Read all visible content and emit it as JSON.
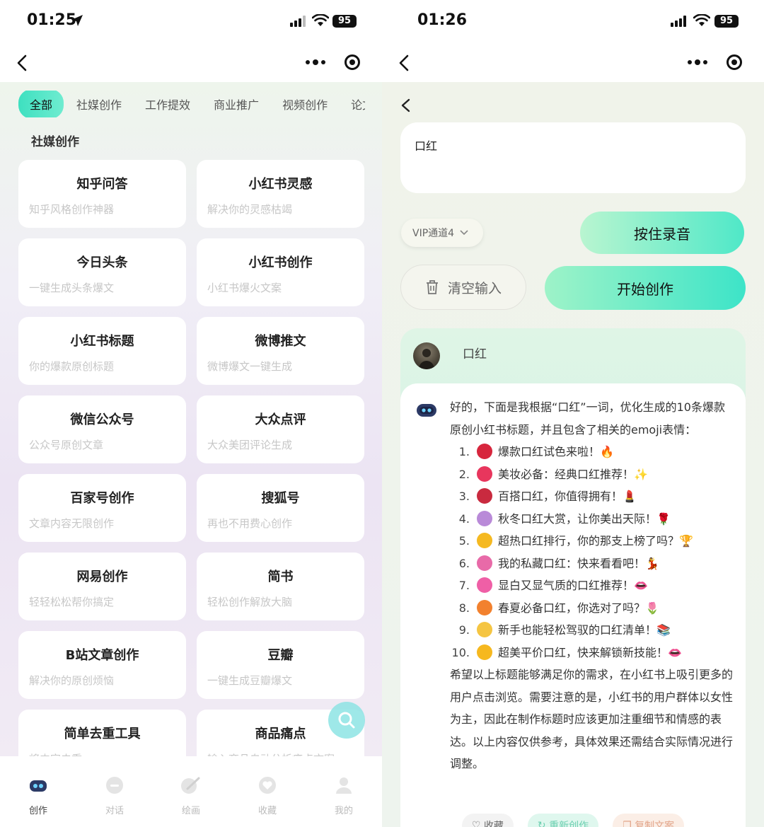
{
  "left": {
    "status": {
      "time": "01:25",
      "battery": "95"
    },
    "tabs": [
      "全部",
      "社媒创作",
      "工作提效",
      "商业推广",
      "视频创作",
      "论文"
    ],
    "section_title": "社媒创作",
    "cards": [
      {
        "title": "知乎问答",
        "subtitle": "知乎风格创作神器"
      },
      {
        "title": "小红书灵感",
        "subtitle": "解决你的灵感枯竭"
      },
      {
        "title": "今日头条",
        "subtitle": "一键生成头条爆文"
      },
      {
        "title": "小红书创作",
        "subtitle": "小红书爆火文案"
      },
      {
        "title": "小红书标题",
        "subtitle": "你的爆款原创标题"
      },
      {
        "title": "微博推文",
        "subtitle": "微博爆文一键生成"
      },
      {
        "title": "微信公众号",
        "subtitle": "公众号原创文章"
      },
      {
        "title": "大众点评",
        "subtitle": "大众美团评论生成"
      },
      {
        "title": "百家号创作",
        "subtitle": "文章内容无限创作"
      },
      {
        "title": "搜狐号",
        "subtitle": "再也不用费心创作"
      },
      {
        "title": "网易创作",
        "subtitle": "轻轻松松帮你搞定"
      },
      {
        "title": "简书",
        "subtitle": "轻松创作解放大脑"
      },
      {
        "title": "B站文章创作",
        "subtitle": "解决你的原创烦恼"
      },
      {
        "title": "豆瓣",
        "subtitle": "一键生成豆瓣爆文"
      },
      {
        "title": "简单去重工具",
        "subtitle": "将内容去重"
      },
      {
        "title": "商品痛点",
        "subtitle": "输入商品自动分析痛点文案"
      }
    ],
    "tabbar": [
      "创作",
      "对话",
      "绘画",
      "收藏",
      "我的"
    ]
  },
  "right": {
    "status": {
      "time": "01:26",
      "battery": "95"
    },
    "input_value": "口红",
    "vip_select": "VIP通道4",
    "record_button": "按住录音",
    "clear_button": "清空输入",
    "start_button": "开始创作",
    "user_message": "口红",
    "answer_intro": "好的，下面是我根据“口红”一词，优化生成的10条爆款原创小红书标题，并且包含了相关的emoji表情：",
    "answer_items": [
      {
        "num": "1.",
        "emoji_color": "#d7263d",
        "text": "爆款口红试色来啦！🔥"
      },
      {
        "num": "2.",
        "emoji_color": "#e8365d",
        "text": "美妆必备：经典口红推荐！✨"
      },
      {
        "num": "3.",
        "emoji_color": "#c92a3f",
        "text": "百搭口红，你值得拥有！💄"
      },
      {
        "num": "4.",
        "emoji_color": "#b98ad8",
        "text": "秋冬口红大赏，让你美出天际！🌹"
      },
      {
        "num": "5.",
        "emoji_color": "#f5b921",
        "text": "超热口红排行，你的那支上榜了吗？🏆"
      },
      {
        "num": "6.",
        "emoji_color": "#e86aa8",
        "text": "我的私藏口红：快来看看吧！💃"
      },
      {
        "num": "7.",
        "emoji_color": "#ef5fa6",
        "text": "显白又显气质的口红推荐！👄"
      },
      {
        "num": "8.",
        "emoji_color": "#f2812e",
        "text": "春夏必备口红，你选对了吗？🌷"
      },
      {
        "num": "9.",
        "emoji_color": "#f5c542",
        "text": "新手也能轻松驾驭的口红清单！📚"
      },
      {
        "num": "10.",
        "emoji_color": "#f6b81f",
        "text": "超美平价口红，快来解锁新技能！👄"
      }
    ],
    "answer_outro": "希望以上标题能够满足你的需求，在小红书上吸引更多的用户点击浏览。需要注意的是，小红书的用户群体以女性为主，因此在制作标题时应该更加注重细节和情感的表达。以上内容仅供参考，具体效果还需结合实际情况进行调整。",
    "actions": {
      "fav": "收藏",
      "regen": "重新创作",
      "copy": "复制文案"
    }
  }
}
